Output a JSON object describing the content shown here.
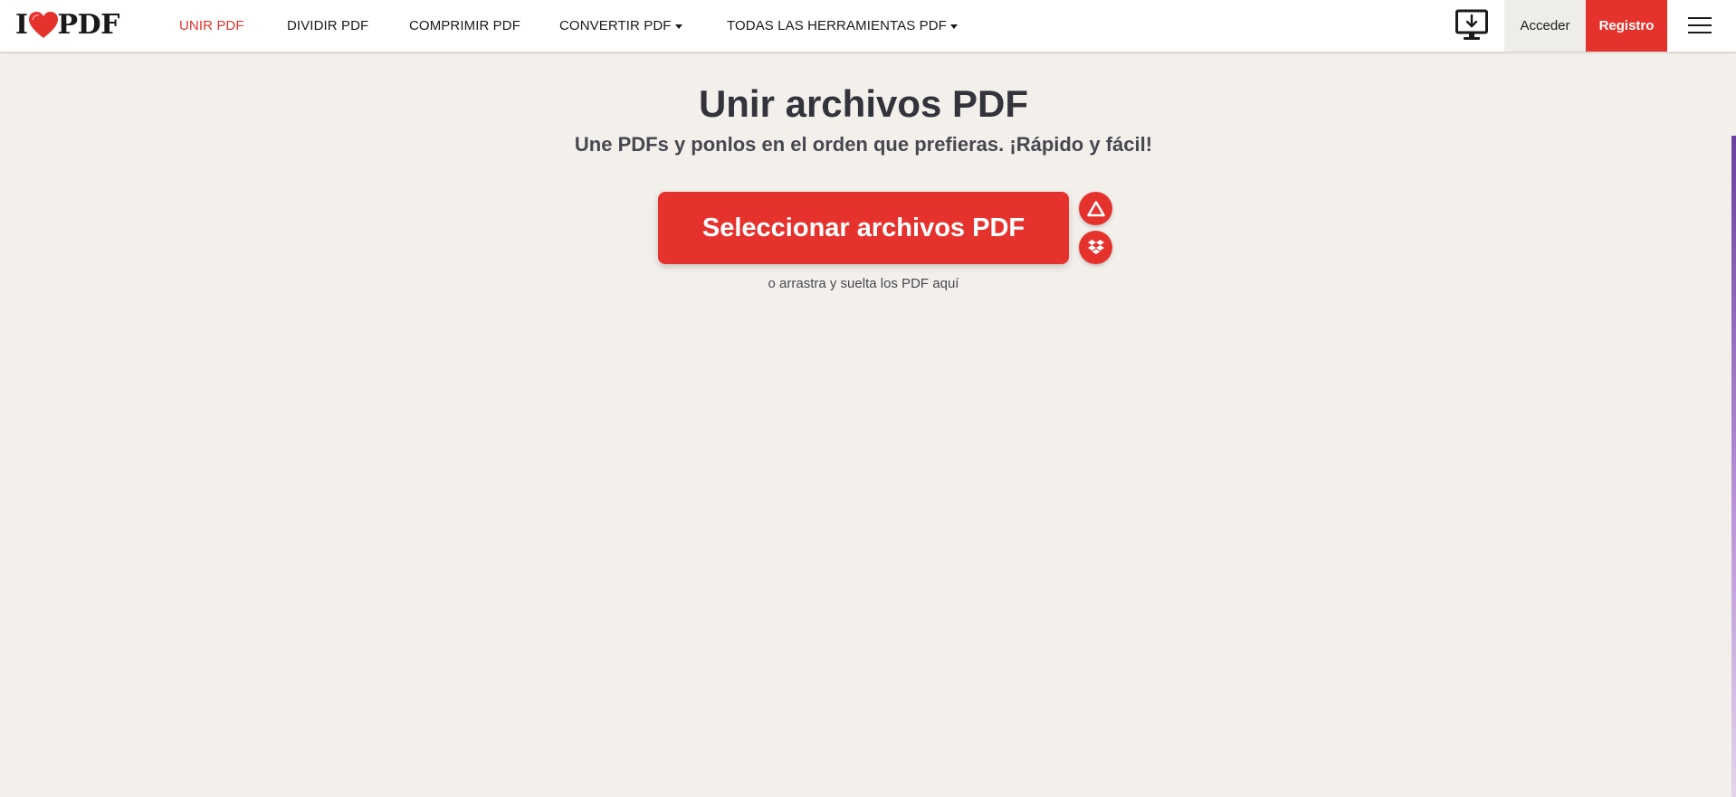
{
  "brand": {
    "logo_left": "I",
    "logo_right": "PDF",
    "accent_color": "#e5322d"
  },
  "nav": {
    "items": [
      {
        "label": "UNIR PDF",
        "active": true
      },
      {
        "label": "DIVIDIR PDF"
      },
      {
        "label": "COMPRIMIR PDF"
      },
      {
        "label": "CONVERTIR PDF",
        "dropdown": true
      },
      {
        "label": "TODAS LAS HERRAMIENTAS PDF",
        "dropdown": true
      }
    ]
  },
  "header_actions": {
    "desktop_icon": "desktop-download-icon",
    "login_label": "Acceder",
    "signup_label": "Registro",
    "menu_icon": "hamburger-menu-icon"
  },
  "main": {
    "title": "Unir archivos PDF",
    "subtitle": "Une PDFs y ponlos en el orden que prefieras. ¡Rápido y fácil!",
    "select_button_label": "Seleccionar archivos PDF",
    "cloud_buttons": [
      {
        "icon": "google-drive-icon"
      },
      {
        "icon": "dropbox-icon"
      }
    ],
    "drop_hint": "o arrastra y suelta los PDF aquí"
  },
  "colors": {
    "background": "#f3f0ec",
    "header_background": "#ffffff",
    "text": "#33333b"
  }
}
